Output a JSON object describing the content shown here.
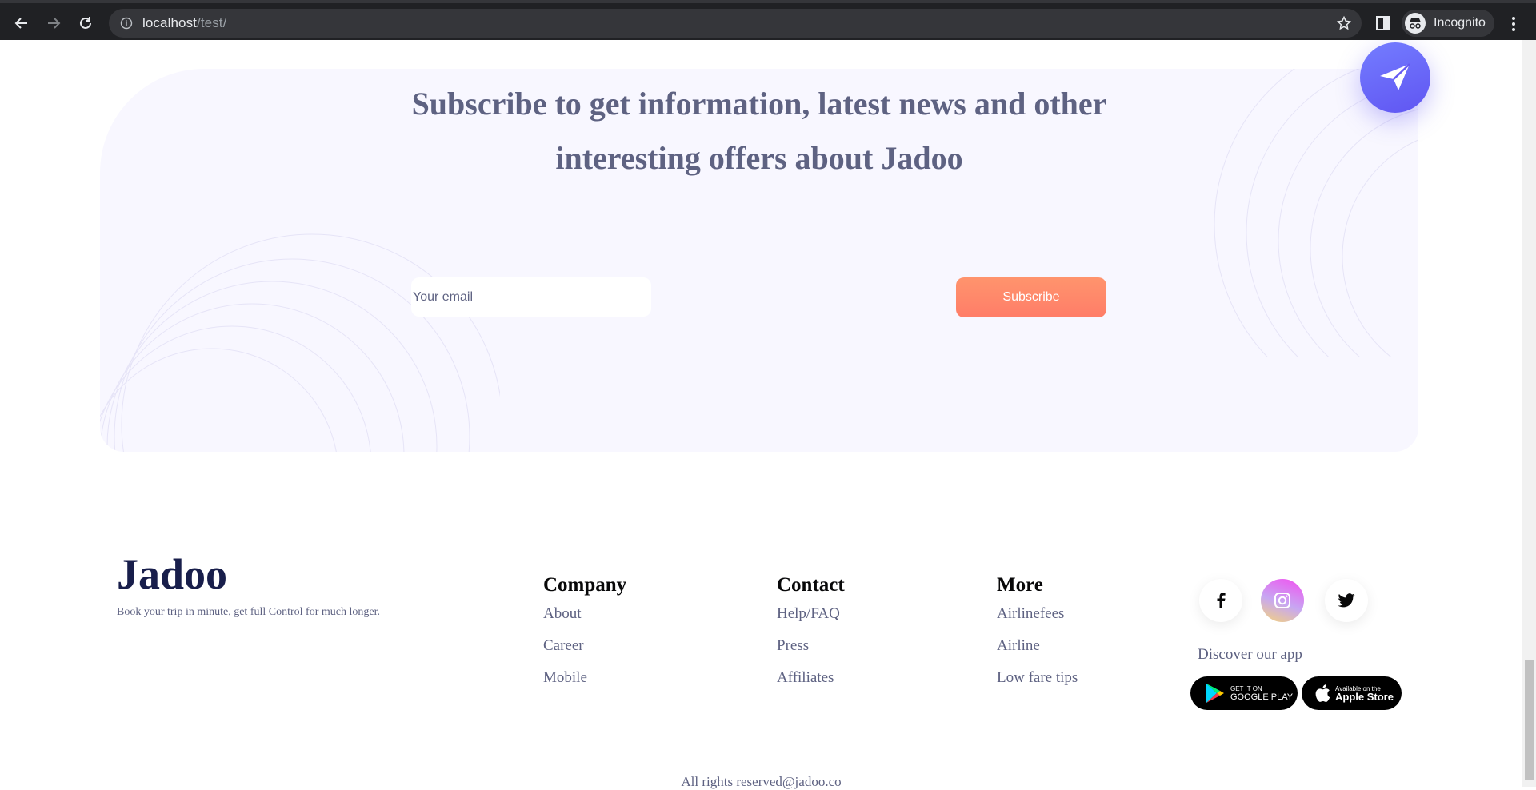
{
  "browser": {
    "url_host": "localhost",
    "url_path": "/test/",
    "profile_label": "Incognito"
  },
  "subscribe": {
    "title_line1": "Subscribe to get information, latest news and other",
    "title_line2": "interesting offers about Jadoo",
    "email_placeholder": "Your email",
    "button_label": "Subscribe"
  },
  "footer": {
    "brand": "Jadoo",
    "tagline": "Book your trip in minute, get full Control for much longer.",
    "columns": [
      {
        "heading": "Company",
        "links": [
          "About",
          "Career",
          "Mobile"
        ]
      },
      {
        "heading": "Contact",
        "links": [
          "Help/FAQ",
          "Press",
          "Affiliates"
        ]
      },
      {
        "heading": "More",
        "links": [
          "Airlinefees",
          "Airline",
          "Low fare tips"
        ]
      }
    ],
    "social": [
      "facebook-icon",
      "instagram-icon",
      "twitter-icon"
    ],
    "discover_label": "Discover our app",
    "google_play": {
      "small": "GET IT ON",
      "big": "GOOGLE PLAY"
    },
    "app_store": {
      "small": "Available on the",
      "big": "Apple Store"
    },
    "copyright": "All rights reserved@jadoo.co"
  },
  "colors": {
    "accent_orange": "#ff7d68",
    "heading_blue": "#181e4b",
    "text_gray": "#5e6282",
    "fab_purple": "#6055f2"
  }
}
